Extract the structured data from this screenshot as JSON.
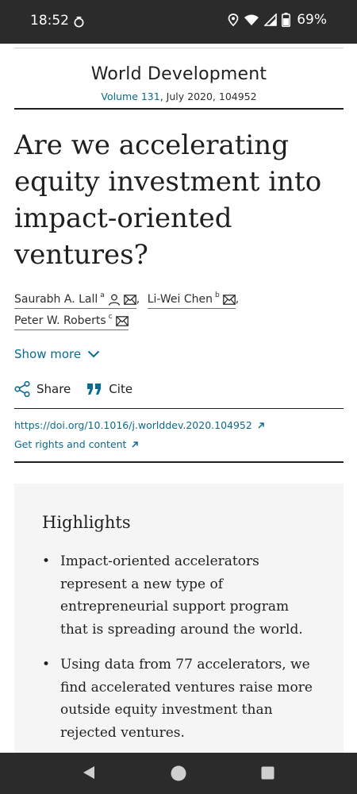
{
  "status_bar": {
    "time": "18:52",
    "battery_percent": "69%",
    "icons": [
      "clock-icon",
      "location-icon",
      "wifi-icon",
      "signal-icon",
      "battery-icon"
    ]
  },
  "journal": {
    "name": "World Development",
    "volume_link": "Volume 131",
    "issue_info": ", July 2020, 104952"
  },
  "article": {
    "title_lines": [
      "Are we accelerating",
      "equity investment into",
      "impact-oriented",
      "ventures?"
    ]
  },
  "authors": [
    {
      "name": "Saurabh A. Lall",
      "sup": "a",
      "icons": [
        "person-icon",
        "mail-icon"
      ],
      "sep": ","
    },
    {
      "name": "Li-Wei Chen",
      "sup": "b",
      "icons": [
        "mail-icon"
      ],
      "sep": ","
    },
    {
      "name": "Peter W. Roberts",
      "sup": "c",
      "icons": [
        "mail-icon"
      ],
      "sep": ""
    }
  ],
  "show_more": {
    "label": "Show more"
  },
  "actions": {
    "share": "Share",
    "cite": "Cite"
  },
  "links": {
    "doi": "https://doi.org/10.1016/j.worlddev.2020.104952",
    "rights": "Get rights and content"
  },
  "highlights": {
    "title": "Highlights",
    "items": [
      {
        "bullet": "•",
        "lines": [
          "Impact-oriented accelerators",
          "represent a new type of",
          "entrepreneurial support program",
          "that is spreading around the world."
        ]
      },
      {
        "bullet": "•",
        "lines": [
          "Using data from 77 accelerators, we",
          "find accelerated ventures raise more",
          "outside equity investment than",
          "rejected ventures."
        ]
      }
    ]
  },
  "colors": {
    "link": "#0a6a91",
    "system_bar": "#2b2b2b",
    "highlights_bg": "#f5f5f5",
    "text": "#1f1f1f"
  }
}
